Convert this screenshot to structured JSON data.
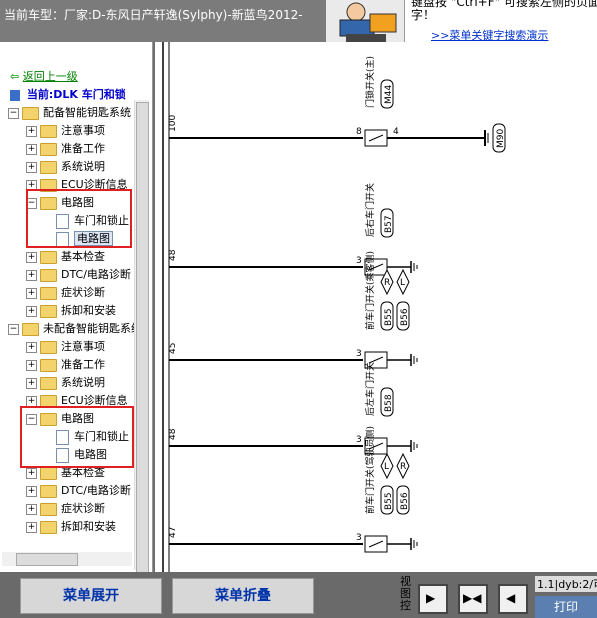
{
  "header": {
    "title": "当前车型：厂家:D-东风日产轩逸(Sylphy)-新蓝鸟2012-",
    "hint_text": "键盘按 \"Ctrl+F\" 可搜索左侧的页面字！",
    "hint_link": ">>菜单关键字搜索演示"
  },
  "sidebar": {
    "back_label": "返回上一级",
    "current_label": "当前:DLK 车门和锁",
    "tree": [
      {
        "label": "配备智能钥匙系统",
        "level": 0,
        "type": "folder",
        "expander": "−"
      },
      {
        "label": "注意事项",
        "level": 1,
        "type": "folder",
        "expander": "+"
      },
      {
        "label": "准备工作",
        "level": 1,
        "type": "folder",
        "expander": "+"
      },
      {
        "label": "系统说明",
        "level": 1,
        "type": "folder",
        "expander": "+"
      },
      {
        "label": "ECU诊断信息",
        "level": 1,
        "type": "folder",
        "expander": "+"
      },
      {
        "label": "电路图",
        "level": 1,
        "type": "folder",
        "expander": "−"
      },
      {
        "label": "车门和锁止",
        "level": 2,
        "type": "doc"
      },
      {
        "label": "电路图",
        "level": 2,
        "type": "doc",
        "selected": true
      },
      {
        "label": "基本检查",
        "level": 1,
        "type": "folder",
        "expander": "+"
      },
      {
        "label": "DTC/电路诊断",
        "level": 1,
        "type": "folder",
        "expander": "+"
      },
      {
        "label": "症状诊断",
        "level": 1,
        "type": "folder",
        "expander": "+"
      },
      {
        "label": "拆卸和安装",
        "level": 1,
        "type": "folder",
        "expander": "+"
      },
      {
        "label": "未配备智能钥匙系统",
        "level": 0,
        "type": "folder",
        "expander": "−"
      },
      {
        "label": "注意事项",
        "level": 1,
        "type": "folder",
        "expander": "+"
      },
      {
        "label": "准备工作",
        "level": 1,
        "type": "folder",
        "expander": "+"
      },
      {
        "label": "系统说明",
        "level": 1,
        "type": "folder",
        "expander": "+"
      },
      {
        "label": "ECU诊断信息",
        "level": 1,
        "type": "folder",
        "expander": "+"
      },
      {
        "label": "电路图",
        "level": 1,
        "type": "folder",
        "expander": "−"
      },
      {
        "label": "车门和锁止",
        "level": 2,
        "type": "doc"
      },
      {
        "label": "电路图",
        "level": 2,
        "type": "doc"
      },
      {
        "label": "基本检查",
        "level": 1,
        "type": "folder",
        "expander": "+"
      },
      {
        "label": "DTC/电路诊断",
        "level": 1,
        "type": "folder",
        "expander": "+"
      },
      {
        "label": "症状诊断",
        "level": 1,
        "type": "folder",
        "expander": "+"
      },
      {
        "label": "拆卸和安装",
        "level": 1,
        "type": "folder",
        "expander": "+"
      }
    ]
  },
  "diagram": {
    "wires": [
      {
        "num": "100",
        "pin": "8",
        "pin2": "4",
        "switch": "门锁开关(主)",
        "connector": "M44",
        "ground_label": "M90"
      },
      {
        "num": "48",
        "pin": "3",
        "switch": "后右车门开关",
        "connector": "B57"
      },
      {
        "num": "45",
        "pin": "3",
        "switch": "前车门开关(乘客侧)",
        "connector": "B55",
        "connector2": "B56",
        "side_a": "R",
        "side_b": "L"
      },
      {
        "num": "48",
        "pin": "3",
        "switch": "后左车门开关",
        "connector": "B58"
      },
      {
        "num": "47",
        "pin": "3",
        "switch": "前车门开关(驾驶员侧)",
        "connector": "B55",
        "connector2": "B56",
        "side_a": "L",
        "side_b": "R"
      }
    ]
  },
  "footer": {
    "expand_label": "菜单展开",
    "collapse_label": "菜单折叠",
    "view_label": "视图控",
    "status": "1.1|dyb:2/可",
    "print_label": "打印"
  }
}
